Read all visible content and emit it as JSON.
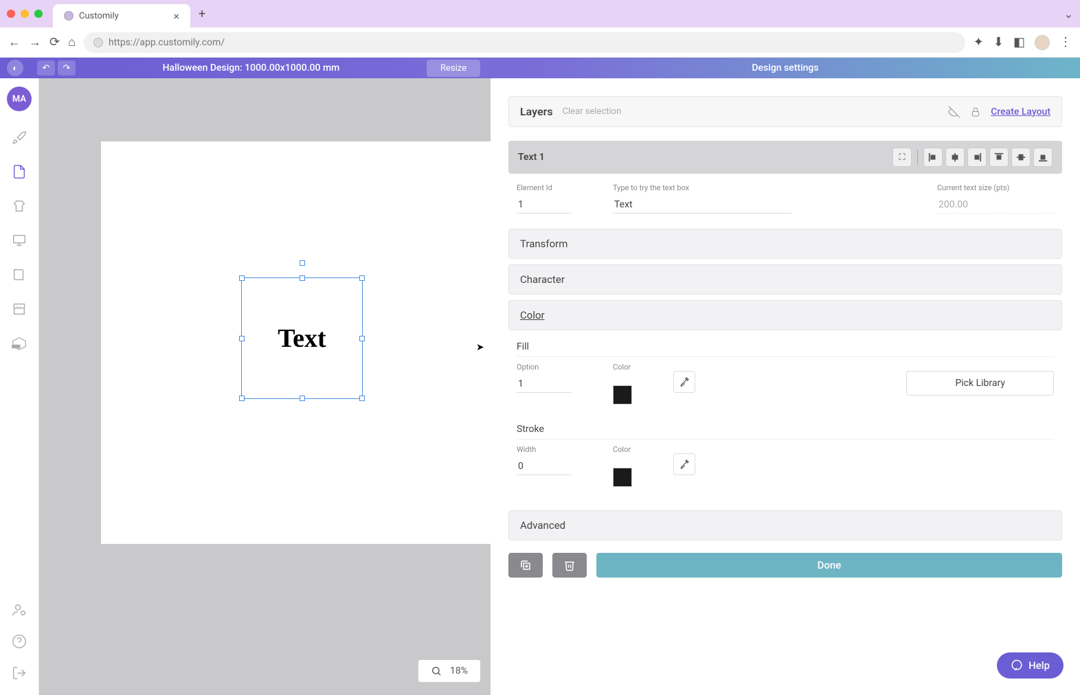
{
  "browser": {
    "tab_title": "Customily",
    "url": "https://app.customily.com/"
  },
  "header": {
    "design_title": "Halloween Design: 1000.00x1000.00 mm",
    "resize_label": "Resize",
    "right_title": "Design settings"
  },
  "user_badge": "MA",
  "canvas": {
    "text_content": "Text",
    "zoom": "18%"
  },
  "layers": {
    "title": "Layers",
    "clear_selection": "Clear selection",
    "create_layout": "Create Layout",
    "selected_layer": "Text 1"
  },
  "element": {
    "id_label": "Element Id",
    "id_value": "1",
    "type_label": "Type to try the text box",
    "type_value": "Text",
    "size_label": "Current text size (pts)",
    "size_value": "200.00"
  },
  "sections": {
    "transform": "Transform",
    "character": "Character",
    "color": "Color",
    "advanced": "Advanced"
  },
  "color": {
    "fill_title": "Fill",
    "option_label": "Option",
    "option_value": "1",
    "color_label": "Color",
    "fill_hex": "#1a1a1a",
    "pick_library": "Pick Library",
    "stroke_title": "Stroke",
    "width_label": "Width",
    "width_value": "0",
    "stroke_hex": "#1a1a1a"
  },
  "actions": {
    "done": "Done"
  },
  "help": "Help"
}
